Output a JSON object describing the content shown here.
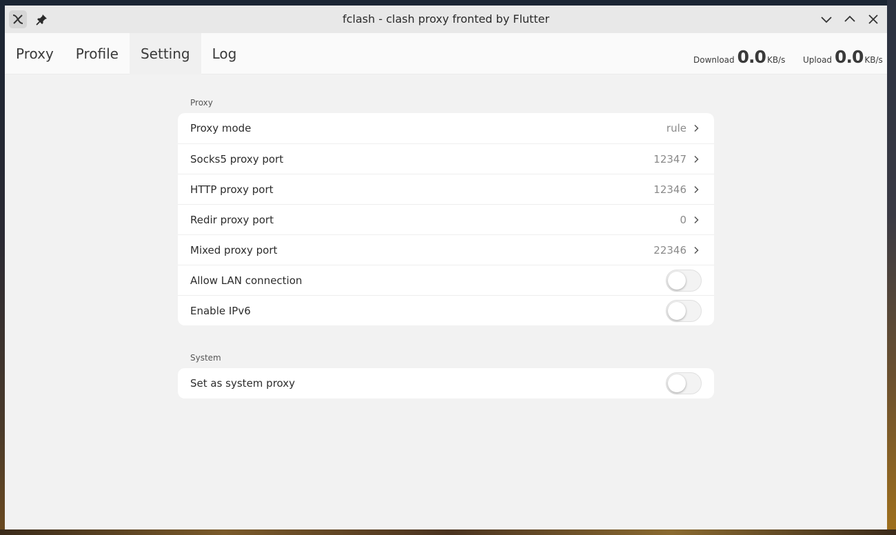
{
  "window": {
    "title": "fclash - clash proxy fronted by Flutter"
  },
  "tabs": [
    {
      "label": "Proxy",
      "active": false
    },
    {
      "label": "Profile",
      "active": false
    },
    {
      "label": "Setting",
      "active": true
    },
    {
      "label": "Log",
      "active": false
    }
  ],
  "traffic": {
    "download": {
      "label": "Download",
      "value": "0.0",
      "unit": "KB/s"
    },
    "upload": {
      "label": "Upload",
      "value": "0.0",
      "unit": "KB/s"
    }
  },
  "sections": {
    "proxy": {
      "title": "Proxy",
      "rows": [
        {
          "label": "Proxy mode",
          "value": "rule"
        },
        {
          "label": "Socks5 proxy port",
          "value": "12347"
        },
        {
          "label": "HTTP proxy port",
          "value": "12346"
        },
        {
          "label": "Redir proxy port",
          "value": "0"
        },
        {
          "label": "Mixed proxy port",
          "value": "22346"
        },
        {
          "label": "Allow LAN connection",
          "toggle": false
        },
        {
          "label": "Enable IPv6",
          "toggle": false
        }
      ]
    },
    "system": {
      "title": "System",
      "rows": [
        {
          "label": "Set as system proxy",
          "toggle": false
        }
      ]
    }
  },
  "icons": {
    "app": "fclash-logo-icon",
    "pin": "pin-icon",
    "minimize": "chevron-down-icon",
    "maximize": "chevron-up-icon",
    "close": "close-icon"
  }
}
